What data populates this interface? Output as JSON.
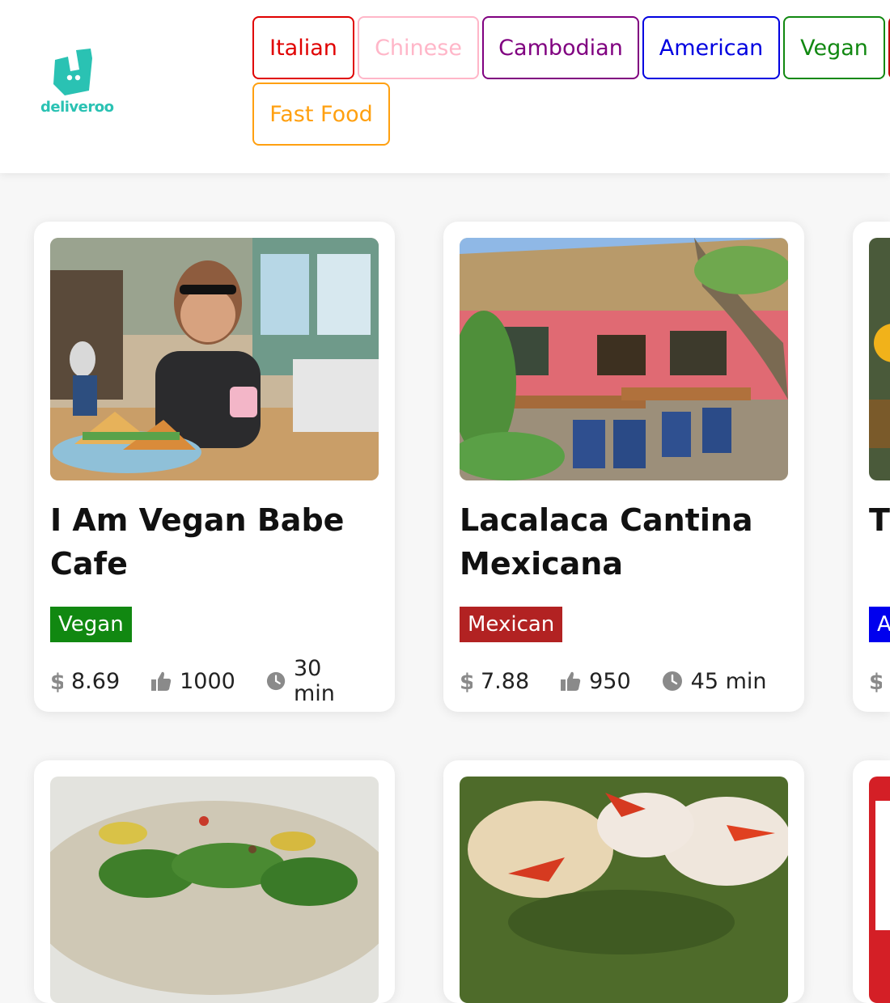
{
  "brand": {
    "name": "deliveroo",
    "color": "#2ac2b3"
  },
  "filters": [
    {
      "label": "Italian",
      "color": "#e00000"
    },
    {
      "label": "Chinese",
      "color": "#ffb6c8"
    },
    {
      "label": "Cambodian",
      "color": "#800080"
    },
    {
      "label": "American",
      "color": "#0000e0"
    },
    {
      "label": "Vegan",
      "color": "#118811"
    },
    {
      "label": "Fast Food",
      "color": "#ffa010"
    }
  ],
  "restaurants": [
    {
      "name": "I Am Vegan Babe Cafe",
      "category": "Vegan",
      "category_color": "#118811",
      "price": "8.69",
      "likes": "1000",
      "time": "30 min"
    },
    {
      "name": "Lacalaca Cantina Mexicana",
      "category": "Mexican",
      "category_color": "#b22222",
      "price": "7.88",
      "likes": "950",
      "time": "45 min"
    },
    {
      "name": "Th",
      "category": "A",
      "category_color": "#0000ee",
      "price": "",
      "likes": "",
      "time": ""
    }
  ],
  "icons": {
    "price": "dollar-icon",
    "likes": "thumbs-up-icon",
    "time": "clock-icon"
  }
}
